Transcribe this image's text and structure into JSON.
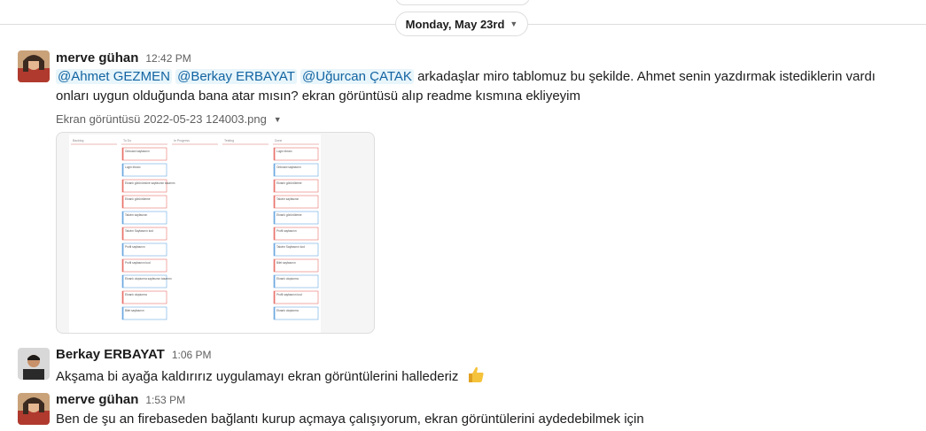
{
  "date_divider": {
    "label": "Monday, May 23rd"
  },
  "messages": [
    {
      "sender": "merve gühan",
      "time": "12:42 PM",
      "mentions": [
        "@Ahmet GEZMEN",
        "@Berkay ERBAYAT",
        "@Uğurcan ÇATAK"
      ],
      "text_after_mentions": " arkadaşlar miro tablomuz bu şekilde. Ahmet senin yazdırmak istediklerin vardı onları uygun olduğunda bana atar mısın? ekran görüntüsü alıp readme kısmına ekliyeyim",
      "attachment": {
        "filename": "Ekran görüntüsü 2022-05-23 124003.png"
      }
    },
    {
      "sender": "Berkay ERBAYAT",
      "time": "1:06 PM",
      "text": "Akşama bi ayağa kaldırırız uygulamayı ekran görüntülerini hallederiz",
      "emoji": "thumbs-up"
    },
    {
      "sender": "merve gühan",
      "time": "1:53 PM",
      "text": "Ben de şu an firebaseden bağlantı kurup açmaya çalışıyorum, ekran görüntülerini aydedebilmek için"
    }
  ],
  "board_preview": {
    "columns": [
      {
        "header": "Backlog",
        "cards": []
      },
      {
        "header": "To Do",
        "cards": [
          "Onboard sayfasının",
          "Login ekranı",
          "Ekranlı görünümüne sayfasının tasarımı",
          "Ekranlı görüntüleme",
          "Takvim sayfasının",
          "Takvim Sayfasının kod",
          "Profil sayfasının",
          "Profil sayfasının kod",
          "Ekranlı oluşturma sayfasının tasarımı",
          "Ekranlı oluşturma",
          "Bilet sayfasının"
        ]
      },
      {
        "header": "In Progress",
        "cards": []
      },
      {
        "header": "Testing",
        "cards": []
      },
      {
        "header": "Done",
        "cards": [
          "Login ekranı",
          "Onboard sayfasının",
          "Ekranlı görüntüleme",
          "Takvim sayfasının",
          "Ekranlı görüntüleme",
          "Profil sayfasının",
          "Takvim Sayfasının kod",
          "Bilet sayfasının",
          "Ekranlı oluşturma",
          "Profil sayfasının kod",
          "Ekranlı oluşturma"
        ]
      }
    ],
    "card_colors": [
      "#e8726b",
      "#6aa8e0",
      "#e8726b",
      "#e8726b",
      "#6aa8e0",
      "#e8726b",
      "#6aa8e0",
      "#e8726b",
      "#6aa8e0",
      "#e8726b",
      "#6aa8e0"
    ]
  }
}
